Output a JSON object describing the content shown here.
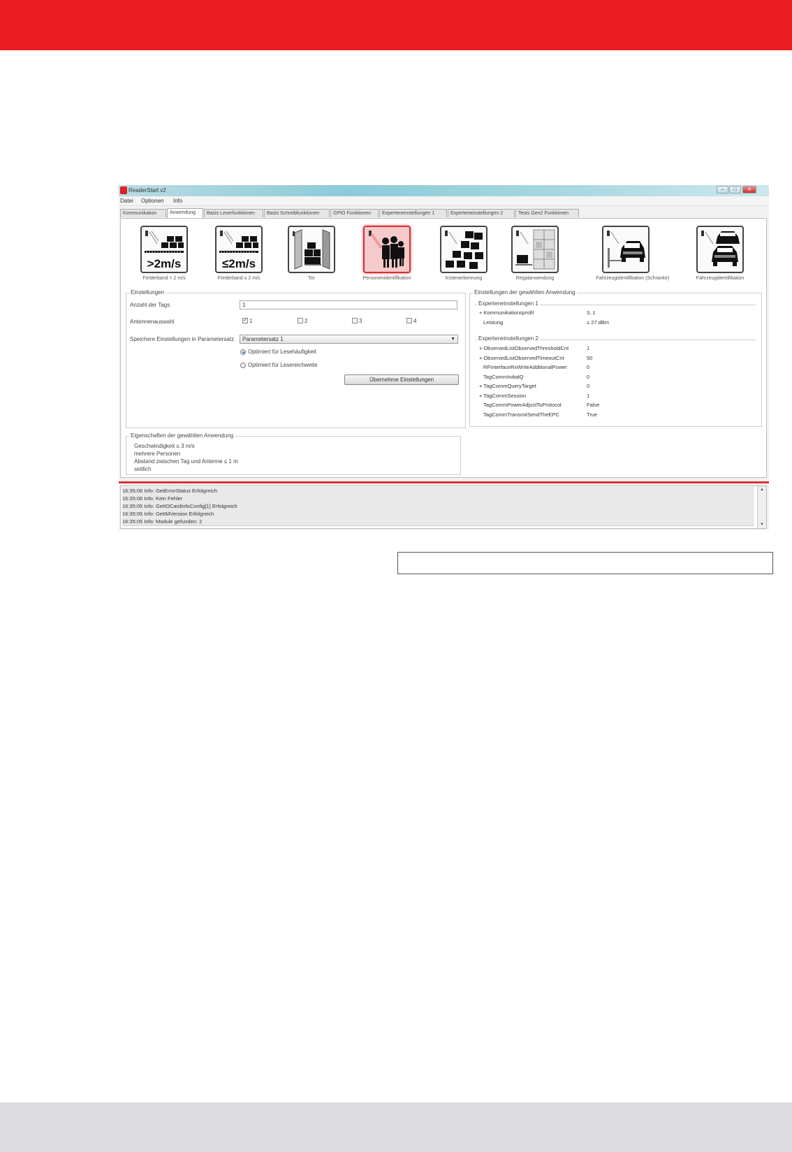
{
  "window": {
    "title": "ReaderStart v2"
  },
  "menu": [
    "Datei",
    "Optionen",
    "Info"
  ],
  "tabs": [
    {
      "label": "Kommunikation",
      "active": false
    },
    {
      "label": "Anwendung",
      "active": true
    },
    {
      "label": "Basis Leserfunktionen",
      "active": false
    },
    {
      "label": "Basis Schreibfunktionen",
      "active": false
    },
    {
      "label": "GPIO Funktionen",
      "active": false
    },
    {
      "label": "Experteneinstellungen 1",
      "active": false
    },
    {
      "label": "Experteneinstellungen 2",
      "active": false
    },
    {
      "label": "Tests Gen2 Funktionen",
      "active": false
    }
  ],
  "applications": [
    {
      "label": "Förderband > 2 m/s",
      "icon": "conveyor-fast-icon",
      "big_text": ">2m/s",
      "selected": false
    },
    {
      "label": "Förderband ≤ 2 m/s",
      "icon": "conveyor-slow-icon",
      "big_text": "≤2m/s",
      "selected": false
    },
    {
      "label": "Tor",
      "icon": "gate-icon",
      "big_text": "",
      "selected": false
    },
    {
      "label": "Personenidentifikation",
      "icon": "people-icon",
      "big_text": "",
      "selected": true
    },
    {
      "label": "Kistenerkennung",
      "icon": "boxes-icon",
      "big_text": "",
      "selected": false
    },
    {
      "label": "Regalanwendung",
      "icon": "shelf-icon",
      "big_text": "",
      "selected": false
    },
    {
      "label": "Fahrzeugidentifikation (Schranke)",
      "icon": "car-barrier-icon",
      "big_text": "",
      "selected": false
    },
    {
      "label": "Fahrzeugidentifikation",
      "icon": "cars-icon",
      "big_text": "",
      "selected": false
    }
  ],
  "settings": {
    "title": "Einstellungen",
    "tag_count_label": "Anzahl der Tags",
    "tag_count_value": "1",
    "antenna_label": "Antennenauswahl",
    "antennas": [
      {
        "label": "1",
        "checked": true
      },
      {
        "label": "2",
        "checked": false
      },
      {
        "label": "3",
        "checked": false
      },
      {
        "label": "4",
        "checked": false
      }
    ],
    "save_label": "Speichere Einstellungen in Parametersatz",
    "param_set": "Parametersatz 1",
    "radio_options": [
      {
        "label": "Optimiert für Lesehäufigkeit",
        "selected": true
      },
      {
        "label": "Optimiert für Lesereichweite",
        "selected": false
      }
    ],
    "apply_button": "Übernehme Einstellungen"
  },
  "expert": {
    "title": "Einstellungen der gewählten Anwendung",
    "section1_title": "Experteneinstellungen 1",
    "section1_rows": [
      {
        "key": "+ Kommunikationsprofil",
        "value": "3, 1"
      },
      {
        "key": "Leistung",
        "value": "≤ 27 dBm"
      }
    ],
    "section2_title": "Experteneinstellungen 2",
    "section2_rows": [
      {
        "key": "+ ObservedListObservedThresholdCnt",
        "value": "1"
      },
      {
        "key": "+ ObservedListObservedTimeoutCnt",
        "value": "50"
      },
      {
        "key": "RFInterfaceRxWriteAdditionalPower",
        "value": "0"
      },
      {
        "key": "TagCommInitialQ",
        "value": "0"
      },
      {
        "key": "+ TagCommQueryTarget",
        "value": "0"
      },
      {
        "key": "+ TagCommSession",
        "value": "1"
      },
      {
        "key": "TagCommPowerAdjustToProtocol",
        "value": "False"
      },
      {
        "key": "TagCommTransmitSendTheEPC",
        "value": "True"
      }
    ]
  },
  "properties": {
    "title": "Eigenschaften der gewählten Anwendung",
    "lines": [
      "Geschwindigkeit ≤ 3 m/s",
      "mehrere Personen",
      "Abstand zwischen Tag und Antenne ≤ 1 m",
      "seitlich"
    ]
  },
  "log": [
    "16:35:06 Info: GetErrorStatus Erfolgreich",
    "16:35:06 Info: Kein Fehler",
    "16:35:05 Info: GetIOCardInfoConfig[1] Erfolgreich",
    "16:35:05 Info: GetIMVersion Erfolgreich",
    "16:35:05 Info: Module gefunden: 2"
  ]
}
